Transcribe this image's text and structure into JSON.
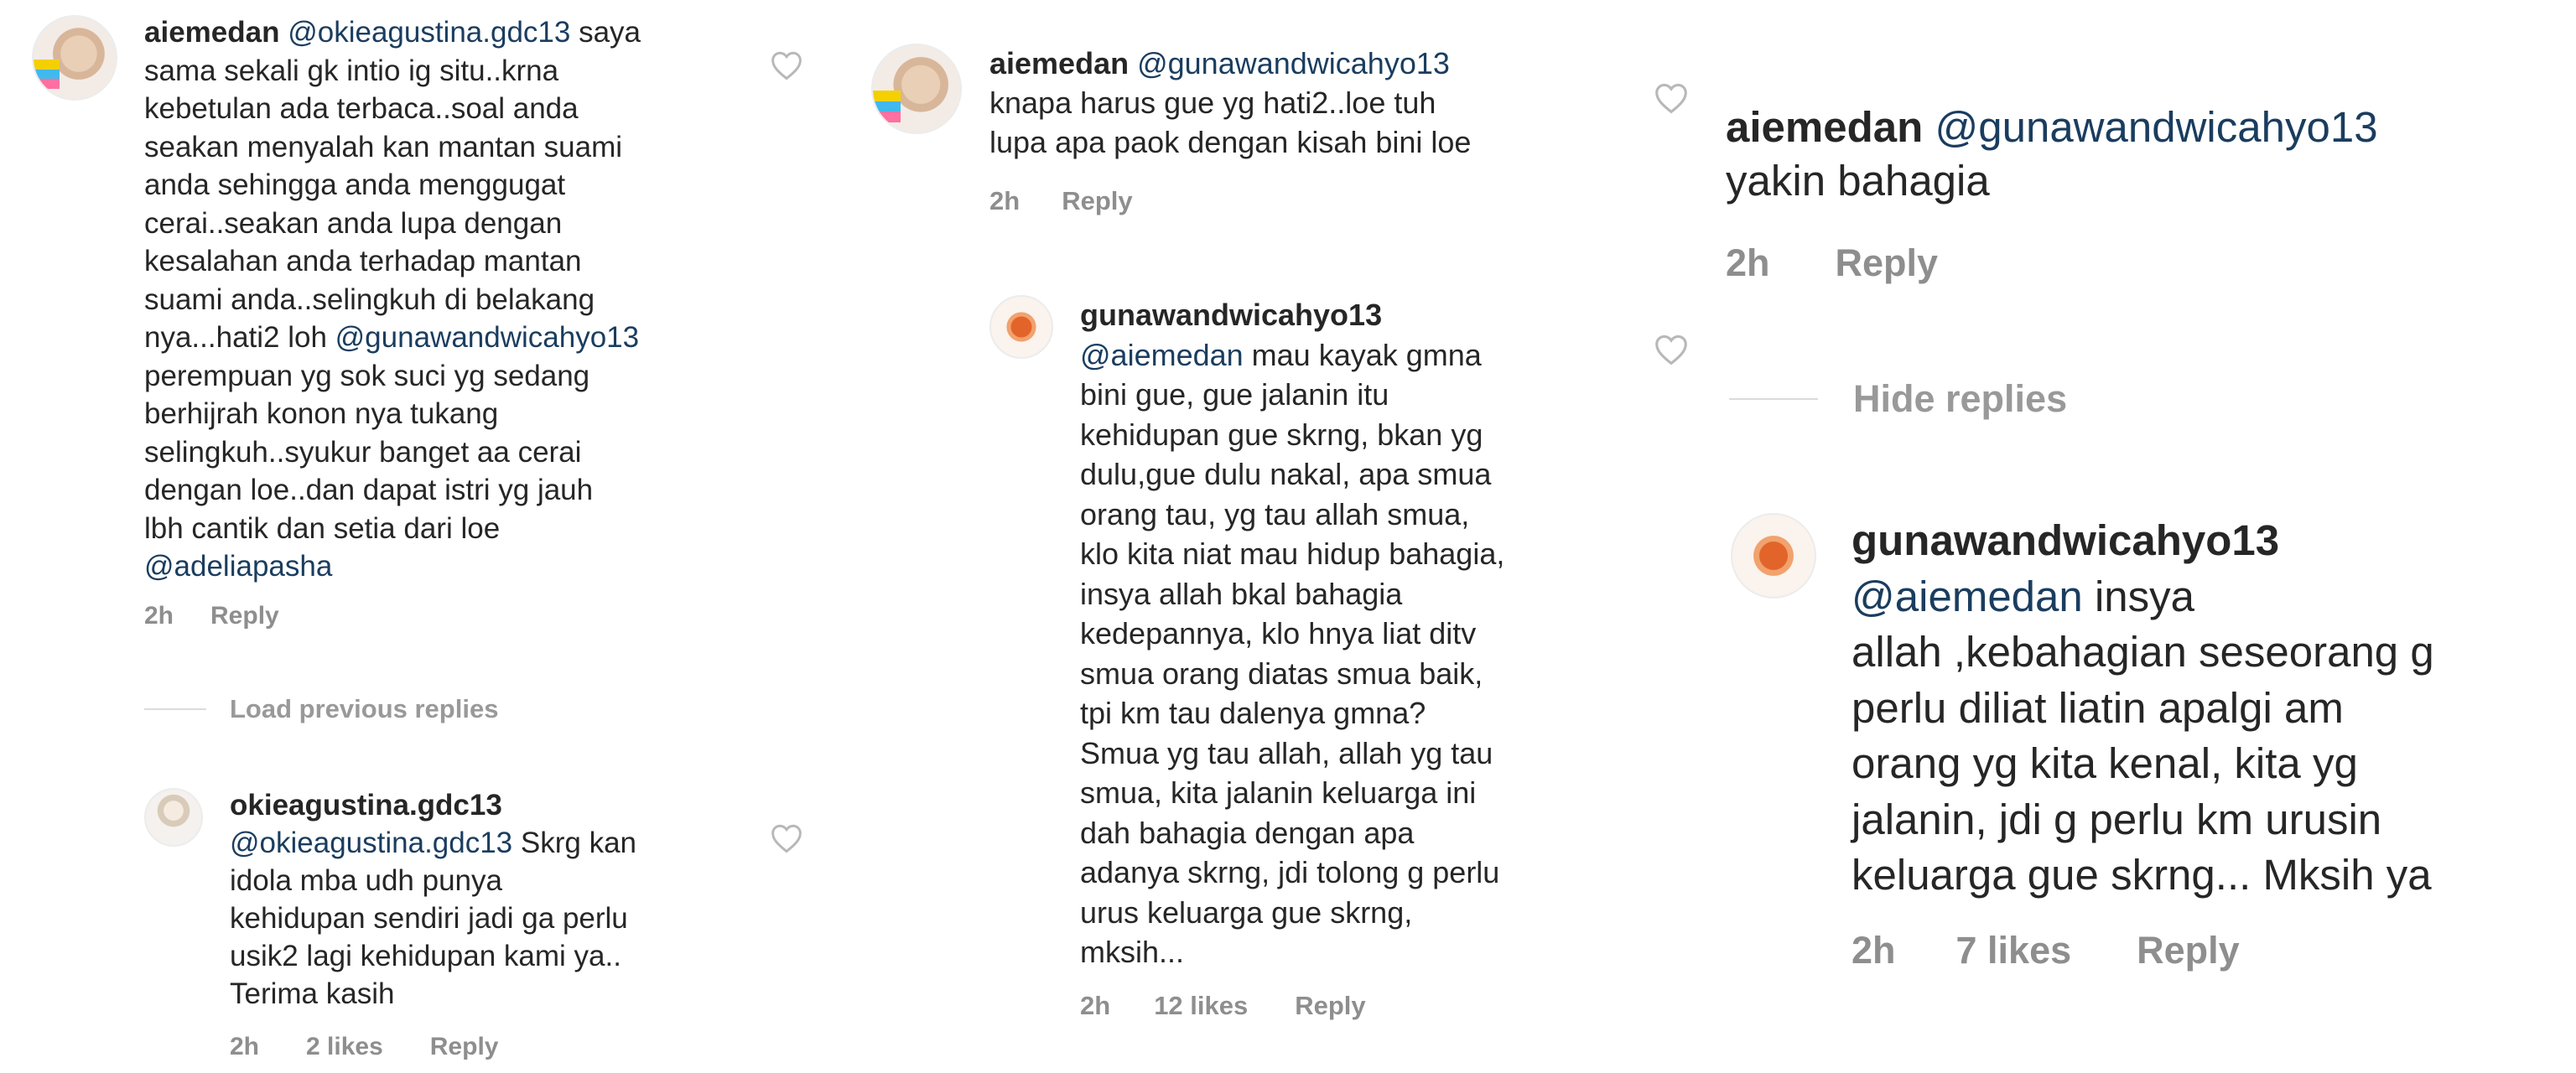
{
  "colors": {
    "text": "#262626",
    "mention": "#1a3d5f",
    "meta": "#8e8e8e",
    "heart": "#b8b8b8",
    "separator": "#dbdbdb"
  },
  "panel1": {
    "comment1": {
      "username": "aiemedan",
      "mention": "@okieagustina.gdc13",
      "text_a": " saya\nsama sekali gk intio ig situ..krna\nkebetulan ada terbaca..soal anda\nseakan menyalah kan mantan suami\nanda sehingga anda menggugat\ncerai..seakan anda lupa dengan\nkesalahan anda terhadap mantan\nsuami anda..selingkuh di belakang\nnya...hati2 loh ",
      "mention2": "@gunawandwicahyo13",
      "text_b": "\nperempuan yg sok suci yg sedang\nberhijrah konon nya tukang\nselingkuh..syukur banget aa cerai\ndengan loe..dan dapat istri yg jauh\nlbh cantik dan setia dari loe\n",
      "mention3": "@adeliapasha",
      "time": "2h",
      "reply": "Reply",
      "avatar_icon": "profile-photo-icon",
      "like_icon": "heart-outline-icon"
    },
    "load_previous": "Load previous replies",
    "reply1": {
      "username": "okieagustina.gdc13",
      "mention": "@okieagustina.gdc13",
      "text": " Skrg kan\nidola mba udh punya\nkehidupan sendiri jadi ga perlu\nusik2 lagi kehidupan kami ya..\nTerima kasih",
      "time": "2h",
      "likes": "2 likes",
      "reply": "Reply",
      "avatar_icon": "profile-photo-icon",
      "like_icon": "heart-outline-icon"
    }
  },
  "panel2": {
    "comment1": {
      "username": "aiemedan",
      "mention": "@gunawandwicahyo13",
      "text": "\nknapa harus gue yg hati2..loe tuh\nlupa apa paok dengan kisah bini loe",
      "time": "2h",
      "reply": "Reply",
      "avatar_icon": "profile-photo-icon",
      "like_icon": "heart-outline-icon"
    },
    "comment2": {
      "username": "gunawandwicahyo13",
      "mention": "@aiemedan",
      "text": " mau kayak gmna\nbini gue, gue jalanin itu\nkehidupan gue skrng, bkan yg\ndulu,gue dulu nakal, apa smua\norang tau, yg tau allah smua,\nklo kita niat mau hidup bahagia,\ninsya allah bkal bahagia\nkedepannya, klo hnya liat ditv\nsmua orang diatas smua baik,\ntpi km tau dalenya gmna?\nSmua yg tau allah, allah yg tau\nsmua, kita jalanin keluarga ini\ndah bahagia dengan apa\nadanya skrng, jdi tolong g perlu\nurus keluarga gue skrng,\nmksih...",
      "time": "2h",
      "likes": "12 likes",
      "reply": "Reply",
      "avatar_icon": "profile-photo-icon",
      "like_icon": "heart-outline-icon"
    }
  },
  "panel3": {
    "comment1": {
      "username": "aiemedan",
      "mention": "@gunawandwicahyo13",
      "text": "\nyakin bahagia",
      "time": "2h",
      "reply": "Reply"
    },
    "hide_replies": "Hide replies",
    "reply1": {
      "username": "gunawandwicahyo13",
      "mention": "@aiemedan",
      "text": " insya\nallah ,kebahagian seseorang g\nperlu diliat liatin apalgi am\norang yg kita kenal, kita yg\njalanin, jdi g perlu km urusin\nkeluarga gue skrng... Mksih ya",
      "time": "2h",
      "likes": "7 likes",
      "reply": "Reply",
      "avatar_icon": "profile-photo-icon"
    }
  }
}
